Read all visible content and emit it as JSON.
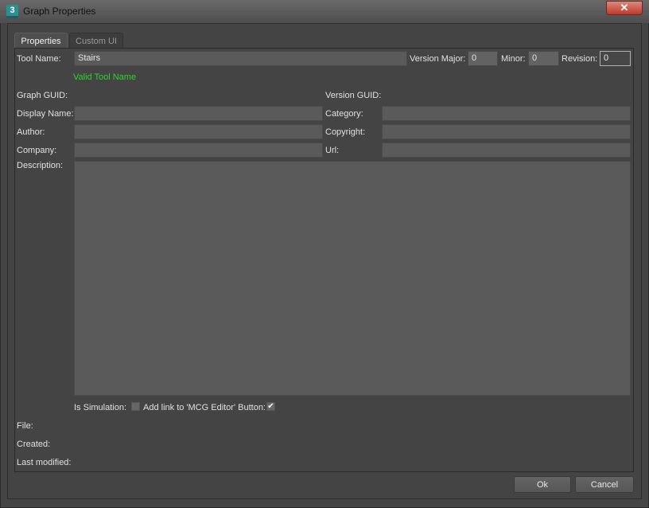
{
  "window": {
    "title": "Graph Properties",
    "icon_text": "3",
    "close_glyph": "✕"
  },
  "tabs": [
    {
      "label": "Properties"
    },
    {
      "label": "Custom UI"
    }
  ],
  "form": {
    "tool_name_label": "Tool Name:",
    "tool_name_value": "Stairs",
    "version_major_label": "Version Major:",
    "version_major_value": "0",
    "minor_label": "Minor:",
    "minor_value": "0",
    "revision_label": "Revision:",
    "revision_value": "0",
    "valid_message": "Valid Tool Name",
    "graph_guid_label": "Graph GUID:",
    "version_guid_label": "Version GUID:",
    "display_name_label": "Display Name:",
    "category_label": "Category:",
    "author_label": "Author:",
    "copyright_label": "Copyright:",
    "company_label": "Company:",
    "url_label": "Url:",
    "description_label": "Description:",
    "is_simulation_label": "Is Simulation:",
    "is_simulation_checked": false,
    "add_link_label": "Add link to 'MCG Editor' Button:",
    "add_link_checked": true,
    "check_glyph": "✔",
    "file_label": "File:",
    "created_label": "Created:",
    "last_modified_label": "Last modified:"
  },
  "buttons": {
    "ok": "Ok",
    "cancel": "Cancel"
  },
  "colors": {
    "valid_text": "#2bd42b",
    "field_bg": "#5a5a5a",
    "dialog_bg": "#444444"
  }
}
